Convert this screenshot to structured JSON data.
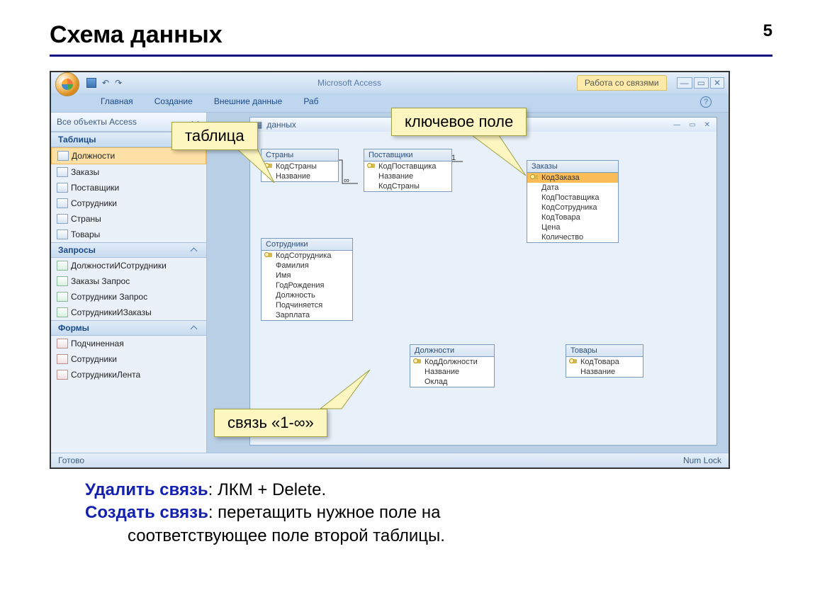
{
  "slide": {
    "title": "Схема данных",
    "page": "5"
  },
  "app": {
    "title": "Microsoft Access",
    "context_tab": "Работа со связями",
    "ribbon": [
      "Главная",
      "Создание",
      "Внешние данные",
      "Раб"
    ],
    "nav_title": "Все объекты Access",
    "sections": {
      "tables": {
        "header": "Таблицы",
        "items": [
          "Должности",
          "Заказы",
          "Поставщики",
          "Сотрудники",
          "Страны",
          "Товары"
        ]
      },
      "queries": {
        "header": "Запросы",
        "items": [
          "ДолжностиИСотрудники",
          "Заказы Запрос",
          "Сотрудники Запрос",
          "СотрудникиИЗаказы"
        ]
      },
      "forms": {
        "header": "Формы",
        "items": [
          "Подчиненная",
          "Сотрудники",
          "СотрудникиЛента"
        ]
      }
    },
    "inner_title": "данных",
    "status_left": "Готово",
    "status_right": "Num Lock"
  },
  "tables": {
    "strany": {
      "title": "Страны",
      "fields": [
        {
          "n": "КодСтраны",
          "k": true
        },
        {
          "n": "Название"
        }
      ]
    },
    "postav": {
      "title": "Поставщики",
      "fields": [
        {
          "n": "КодПоставщика",
          "k": true
        },
        {
          "n": "Название"
        },
        {
          "n": "КодСтраны"
        }
      ]
    },
    "zakazy": {
      "title": "Заказы",
      "fields": [
        {
          "n": "КодЗаказа",
          "k": true,
          "sel": true
        },
        {
          "n": "Дата"
        },
        {
          "n": "КодПоставщика"
        },
        {
          "n": "КодСотрудника"
        },
        {
          "n": "КодТовара"
        },
        {
          "n": "Цена"
        },
        {
          "n": "Количество"
        }
      ]
    },
    "sotr": {
      "title": "Сотрудники",
      "fields": [
        {
          "n": "КодСотрудника",
          "k": true
        },
        {
          "n": "Фамилия"
        },
        {
          "n": "Имя"
        },
        {
          "n": "ГодРождения"
        },
        {
          "n": "Должность"
        },
        {
          "n": "Подчиняется"
        },
        {
          "n": "Зарплата"
        }
      ]
    },
    "dolzh": {
      "title": "Должности",
      "fields": [
        {
          "n": "КодДолжности",
          "k": true
        },
        {
          "n": "Название"
        },
        {
          "n": "Оклад"
        }
      ]
    },
    "tovary": {
      "title": "Товары",
      "fields": [
        {
          "n": "КодТовара",
          "k": true
        },
        {
          "n": "Название"
        }
      ]
    }
  },
  "callouts": {
    "table": "таблица",
    "keyfield": "ключевое поле",
    "relation": "связь «1-∞»"
  },
  "rel_labels": {
    "one": "1",
    "inf": "∞"
  },
  "notes": {
    "l1a": "Удалить связь",
    "l1b": ": ЛКМ + Delete.",
    "l2a": "Создать связь",
    "l2b": ": перетащить нужное поле на",
    "l3": "соответствующее поле второй таблицы."
  }
}
